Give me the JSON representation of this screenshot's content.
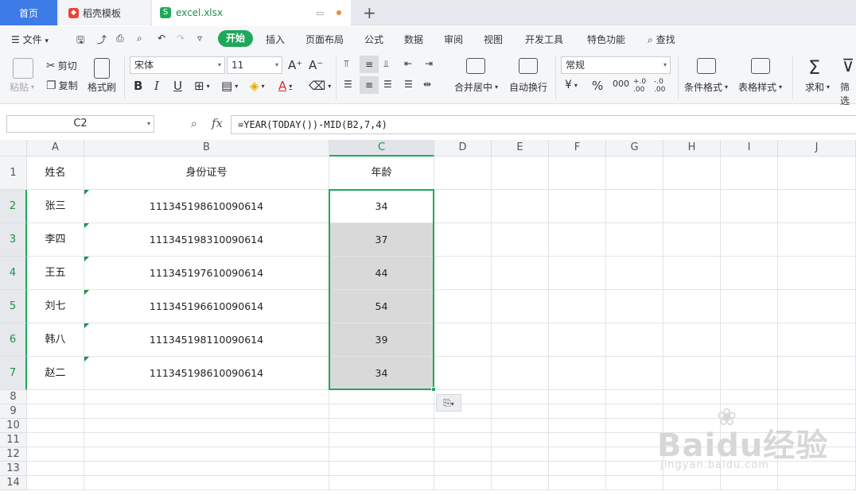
{
  "tabs": {
    "home": "首页",
    "template": "稻壳模板",
    "file": "excel.xlsx"
  },
  "menu": {
    "file": "文件",
    "items": [
      "开始",
      "插入",
      "页面布局",
      "公式",
      "数据",
      "审阅",
      "视图",
      "开发工具",
      "特色功能"
    ],
    "search": "查找"
  },
  "ribbon": {
    "paste": "粘贴",
    "cut": "剪切",
    "copy": "复制",
    "format_painter": "格式刷",
    "font_name": "宋体",
    "font_size": "11",
    "merge_center": "合并居中",
    "wrap_text": "自动换行",
    "number_format": "常规",
    "conditional_format": "条件格式",
    "table_style": "表格样式",
    "sum": "求和",
    "filter": "筛选"
  },
  "formula_bar": {
    "name_box": "C2",
    "fx": "fx",
    "formula": "=YEAR(TODAY())-MID(B2,7,4)"
  },
  "sheet": {
    "columns": [
      "A",
      "B",
      "C",
      "D",
      "E",
      "F",
      "G",
      "H",
      "I",
      "J"
    ],
    "row_numbers": [
      "1",
      "2",
      "3",
      "4",
      "5",
      "6",
      "7",
      "8",
      "9",
      "10",
      "11",
      "12",
      "13",
      "14"
    ],
    "headers": [
      "姓名",
      "身份证号",
      "年龄"
    ],
    "rows": [
      [
        "张三",
        "111345198610090614",
        "34"
      ],
      [
        "李四",
        "111345198310090614",
        "37"
      ],
      [
        "王五",
        "111345197610090614",
        "44"
      ],
      [
        "刘七",
        "111345196610090614",
        "54"
      ],
      [
        "韩八",
        "111345198110090614",
        "39"
      ],
      [
        "赵二",
        "111345198610090614",
        "34"
      ]
    ]
  },
  "watermark": {
    "brand": "Baidu经验",
    "url": "jingyan.baidu.com"
  },
  "colors": {
    "accent": "#1fa85a",
    "home_tab": "#3d7be8",
    "selection_fill": "#d9d9d9"
  }
}
